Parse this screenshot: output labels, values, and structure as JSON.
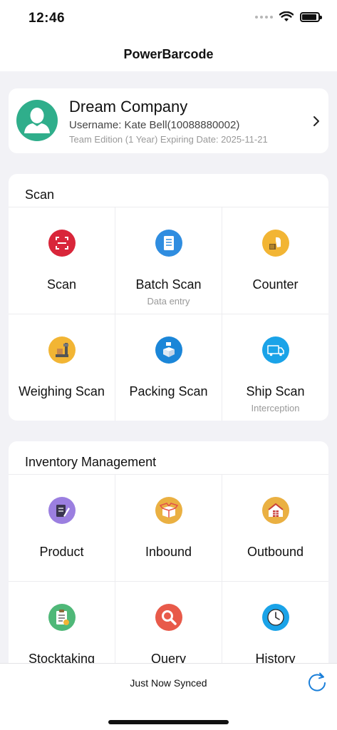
{
  "status_bar": {
    "time": "12:46"
  },
  "nav": {
    "title": "PowerBarcode"
  },
  "profile": {
    "company": "Dream Company",
    "username": "Username: Kate Bell(10088880002)",
    "edition": "Team Edition (1 Year)  Expiring Date: 2025-11-21"
  },
  "scan_section": {
    "title": "Scan",
    "items": [
      {
        "label": "Scan",
        "sub": "",
        "icon": "scan-icon",
        "color": "#d9263a"
      },
      {
        "label": "Batch Scan",
        "sub": "Data entry",
        "icon": "document-icon",
        "color": "#2f8de0"
      },
      {
        "label": "Counter",
        "sub": "",
        "icon": "counter-icon",
        "color": "#f2b534"
      },
      {
        "label": "Weighing Scan",
        "sub": "",
        "icon": "scale-icon",
        "color": "#f2b534"
      },
      {
        "label": "Packing Scan",
        "sub": "",
        "icon": "box-icon",
        "color": "#1b86d8"
      },
      {
        "label": "Ship Scan",
        "sub": "Interception",
        "icon": "truck-icon",
        "color": "#1aa3e8"
      }
    ]
  },
  "inventory_section": {
    "title": "Inventory Management",
    "items": [
      {
        "label": "Product",
        "icon": "product-icon",
        "color": "#9b7fe0"
      },
      {
        "label": "Inbound",
        "icon": "open-box-icon",
        "color": "#eab042"
      },
      {
        "label": "Outbound",
        "icon": "warehouse-icon",
        "color": "#eab042"
      },
      {
        "label": "Stocktaking",
        "icon": "clipboard-icon",
        "color": "#4fb878"
      },
      {
        "label": "Query",
        "icon": "magnifier-icon",
        "color": "#e85a4a"
      },
      {
        "label": "History",
        "icon": "clock-icon",
        "color": "#1aa3e8"
      }
    ]
  },
  "bottom": {
    "sync_status": "Just Now Synced"
  },
  "colors": {
    "accent": "#1a7fd9",
    "avatar": "#2fae8b",
    "background": "#f2f2f6"
  }
}
